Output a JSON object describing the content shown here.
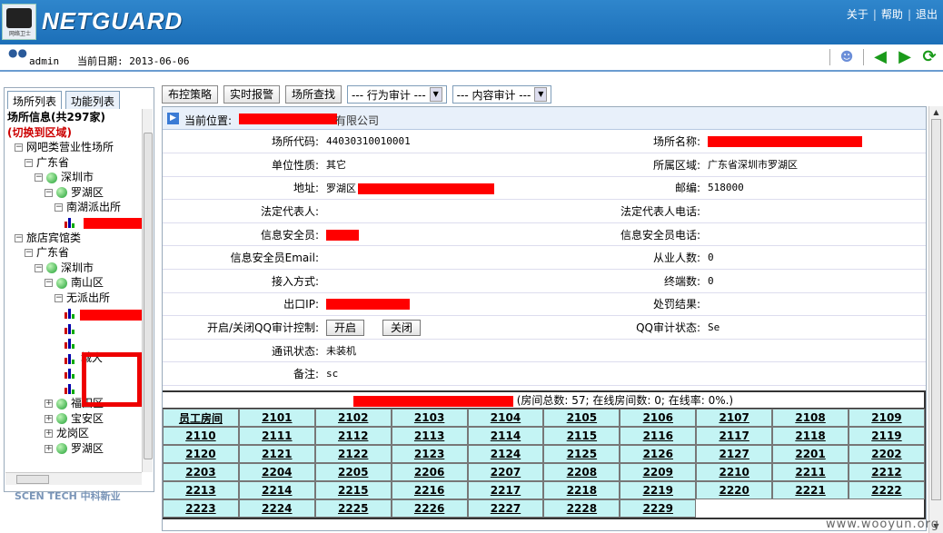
{
  "brand": {
    "name": "NETGUARD",
    "logo_caption": "网络卫士"
  },
  "toplinks": [
    "关于",
    "帮助",
    "退出"
  ],
  "infobar": {
    "user": "admin",
    "date_label": "当前日期:",
    "date": "2013-06-06"
  },
  "nav_icons": [
    "user-icon",
    "back-arrow-icon",
    "forward-arrow-icon",
    "refresh-icon"
  ],
  "left_tabs": [
    "场所列表",
    "功能列表"
  ],
  "tree": {
    "title": "场所信息(共297家)",
    "switch_label": "(切换到区域)",
    "nodes": [
      {
        "label": "网吧类营业性场所",
        "depth": 0,
        "icon": "none",
        "exp": "−"
      },
      {
        "label": "广东省",
        "depth": 1,
        "icon": "none",
        "exp": "−"
      },
      {
        "label": "深圳市",
        "depth": 2,
        "icon": "globe",
        "exp": "−"
      },
      {
        "label": "罗湖区",
        "depth": 3,
        "icon": "globe",
        "exp": "−"
      },
      {
        "label": "南湖派出所",
        "depth": 4,
        "icon": "none",
        "exp": "−"
      },
      {
        "label": "",
        "depth": 5,
        "icon": "bars",
        "exp": ""
      },
      {
        "label": "旅店宾馆类",
        "depth": 0,
        "icon": "none",
        "exp": "−"
      },
      {
        "label": "广东省",
        "depth": 1,
        "icon": "none",
        "exp": "−"
      },
      {
        "label": "深圳市",
        "depth": 2,
        "icon": "globe",
        "exp": "−"
      },
      {
        "label": "南山区",
        "depth": 3,
        "icon": "globe",
        "exp": "−"
      },
      {
        "label": "无派出所",
        "depth": 4,
        "icon": "none",
        "exp": "−"
      },
      {
        "label": "",
        "depth": 5,
        "icon": "bars",
        "exp": ""
      },
      {
        "label": "",
        "depth": 5,
        "icon": "bars",
        "exp": ""
      },
      {
        "label": "",
        "depth": 5,
        "icon": "bars",
        "exp": ""
      },
      {
        "label": "城大",
        "depth": 5,
        "icon": "bars",
        "exp": ""
      },
      {
        "label": "",
        "depth": 5,
        "icon": "bars",
        "exp": ""
      },
      {
        "label": "",
        "depth": 5,
        "icon": "bars",
        "exp": ""
      },
      {
        "label": "福田区",
        "depth": 3,
        "icon": "globe",
        "exp": "+"
      },
      {
        "label": "宝安区",
        "depth": 3,
        "icon": "globe",
        "exp": "+"
      },
      {
        "label": "龙岗区",
        "depth": 3,
        "icon": "none",
        "exp": "+"
      },
      {
        "label": "罗湖区",
        "depth": 3,
        "icon": "globe",
        "exp": "+"
      }
    ]
  },
  "bottom_logo": "SCEN TECH 中科新业",
  "toolbar": {
    "buttons": [
      "布控策略",
      "实时报警",
      "场所查找"
    ],
    "selects": [
      "--- 行为审计 ---",
      "--- 内容审计 ---"
    ]
  },
  "position": {
    "label": "当前位置:",
    "tail": "有限公司"
  },
  "info_rows": [
    {
      "l1": "场所代码:",
      "v1": "44030310010001",
      "l2": "场所名称:",
      "v2": ""
    },
    {
      "l1": "单位性质:",
      "v1": "其它",
      "l2": "所属区域:",
      "v2": "广东省深圳市罗湖区"
    },
    {
      "l1": "地址:",
      "v1": "罗湖区",
      "l2": "邮编:",
      "v2": "518000"
    },
    {
      "l1": "法定代表人:",
      "v1": "",
      "l2": "法定代表人电话:",
      "v2": ""
    },
    {
      "l1": "信息安全员:",
      "v1": "",
      "l2": "信息安全员电话:",
      "v2": ""
    },
    {
      "l1": "信息安全员Email:",
      "v1": "",
      "l2": "从业人数:",
      "v2": "0"
    },
    {
      "l1": "接入方式:",
      "v1": "",
      "l2": "终端数:",
      "v2": "0"
    },
    {
      "l1": "出口IP:",
      "v1": "",
      "l2": "处罚结果:",
      "v2": ""
    },
    {
      "l1": "开启/关闭QQ审计控制:",
      "v1": "",
      "l2": "QQ审计状态:",
      "v2": "Se"
    },
    {
      "l1": "通讯状态:",
      "v1": "未装机",
      "l2": "",
      "v2": ""
    },
    {
      "l1": "备注:",
      "v1": "sc",
      "l2": "",
      "v2": ""
    }
  ],
  "qq_buttons": {
    "open": "开启",
    "close": "关闭"
  },
  "rooms": {
    "summary": "(房间总数: 57; 在线房间数: 0; 在线率: 0%.)",
    "header_cell": "员工房间",
    "list": [
      "2101",
      "2102",
      "2103",
      "2104",
      "2105",
      "2106",
      "2107",
      "2108",
      "2109",
      "2110",
      "2111",
      "2112",
      "2113",
      "2114",
      "2115",
      "2116",
      "2117",
      "2118",
      "2119",
      "2120",
      "2121",
      "2122",
      "2123",
      "2124",
      "2125",
      "2126",
      "2127",
      "2201",
      "2202",
      "2203",
      "2204",
      "2205",
      "2206",
      "2207",
      "2208",
      "2209",
      "2210",
      "2211",
      "2212",
      "2213",
      "2214",
      "2215",
      "2216",
      "2217",
      "2218",
      "2219",
      "2220",
      "2221",
      "2222",
      "2223",
      "2224",
      "2225",
      "2226",
      "2227",
      "2228",
      "2229"
    ]
  },
  "watermark": "www.wooyun.org"
}
